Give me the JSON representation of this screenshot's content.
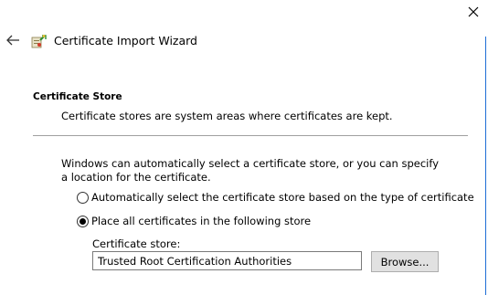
{
  "window": {
    "title": "Certificate Import Wizard"
  },
  "icons": {
    "close": "close-icon",
    "back": "back-arrow-icon",
    "wizard": "certificate-wizard-icon"
  },
  "section": {
    "heading": "Certificate Store",
    "description": "Certificate stores are system areas where certificates are kept."
  },
  "body": {
    "intro": "Windows can automatically select a certificate store, or you can specify a location for the certificate."
  },
  "options": [
    {
      "label": "Automatically select the certificate store based on the type of certificate",
      "selected": false
    },
    {
      "label": "Place all certificates in the following store",
      "selected": true
    }
  ],
  "store": {
    "label": "Certificate store:",
    "value": "Trusted Root Certification Authorities"
  },
  "buttons": {
    "browse": "Browse..."
  },
  "colors": {
    "accent_edge": "#1e6ed6"
  }
}
